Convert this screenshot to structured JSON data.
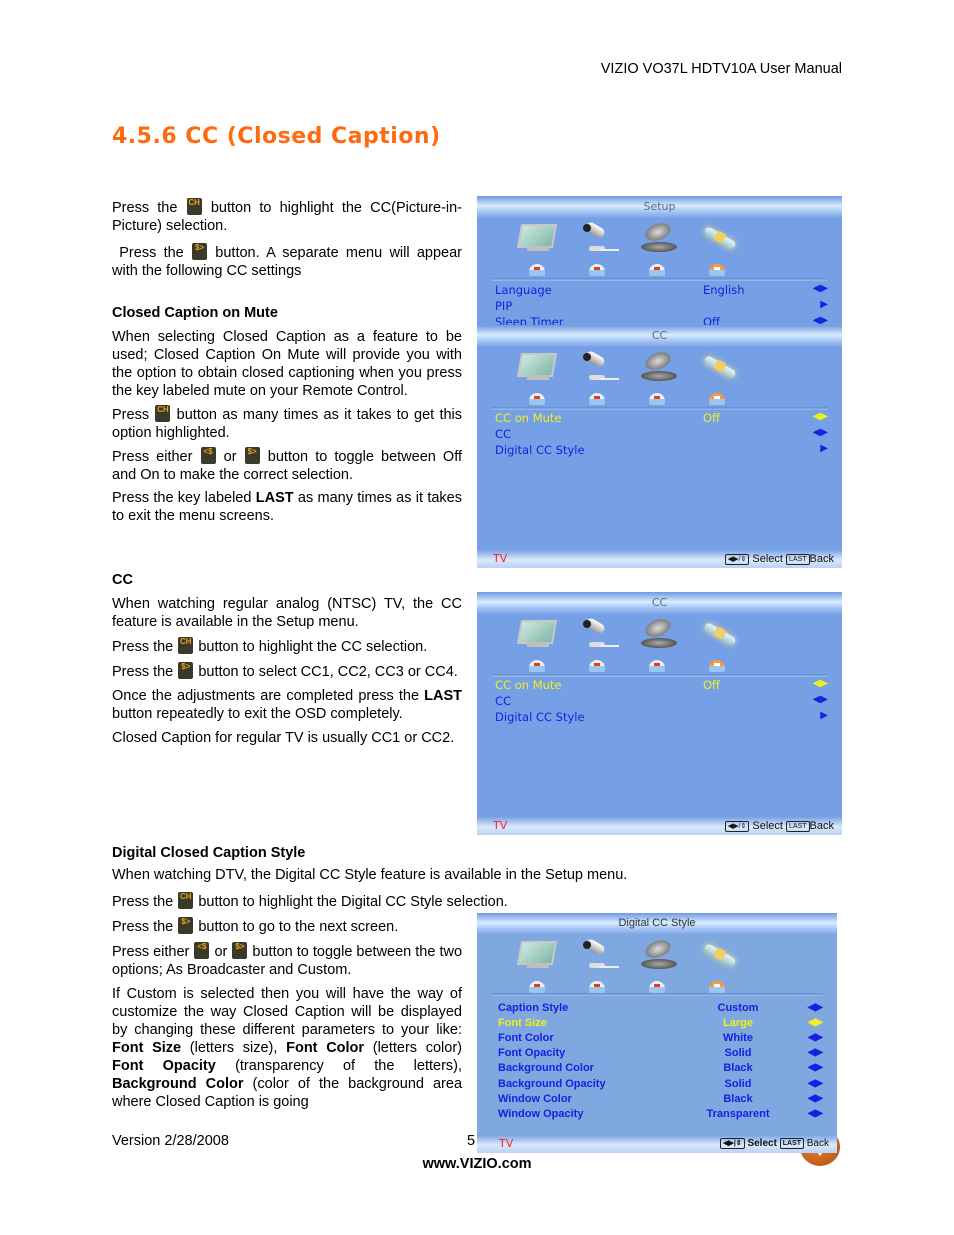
{
  "header": {
    "doc_title": "VIZIO VO37L HDTV10A User Manual"
  },
  "section_title": "4.5.6 CC (Closed Caption)",
  "intro": {
    "p1_a": "Press the",
    "p1_b": "button to highlight the CC(Picture-in-Picture) selection.",
    "p2_a": "Press the",
    "p2_b": "button. A separate menu will appear with the following CC settings"
  },
  "cc_on_mute": {
    "heading": "Closed Caption on Mute",
    "p1": "When selecting Closed Caption as a feature to be used; Closed Caption On Mute will provide you with the option to obtain closed captioning when you press the key labeled mute on your Remote Control.",
    "p2_a": "Press",
    "p2_b": "button as many times as it takes to get this option highlighted.",
    "p3_a": "Press either",
    "p3_or": "or",
    "p3_b": "button to toggle between Off and On to make the correct selection.",
    "p4_a": "Press the key labeled",
    "p4_bold": "LAST",
    "p4_b": "as many times as it takes to exit the menu screens."
  },
  "cc": {
    "heading": "CC",
    "p1": "When watching regular analog (NTSC) TV, the CC feature is available in the Setup menu.",
    "p2_a": "Press the",
    "p2_b": "button to highlight the CC selection.",
    "p3_a": "Press the",
    "p3_b": "button to select CC1, CC2, CC3 or CC4.",
    "p4_a": "Once the adjustments are completed press the",
    "p4_bold": "LAST",
    "p4_b": "button repeatedly to exit the OSD completely.",
    "p5": "Closed Caption for regular TV is usually CC1 or CC2."
  },
  "digital": {
    "heading": "Digital Closed Caption Style",
    "p1": "When watching DTV, the Digital CC Style feature is available in the Setup menu.",
    "p2_a": "Press the",
    "p2_b": "button to highlight the Digital CC Style selection.",
    "p3_a": "Press the",
    "p3_b": "button to go to the next screen.",
    "p4_a": "Press either",
    "p4_or": "or",
    "p4_b": "button to toggle between the two options; As Broadcaster and Custom.",
    "p5_a": "If Custom is selected then you will have the way of customize the way Closed Caption will be displayed by changing these different parameters to your like:",
    "p5_fs": "Font Size",
    "p5_fs_d": "(letters size),",
    "p5_fc": "Font Color",
    "p5_fc_d": "(letters color)",
    "p5_fo": "Font Opacity",
    "p5_fo_d": "(transparency of the letters),",
    "p5_bc": "Background Color",
    "p5_bc_d": "(color of the background area where Closed Caption is going"
  },
  "remote_buttons": {
    "ch_down": "CH",
    "vol_right": "$>",
    "vol_left": "<$"
  },
  "osd_setup": {
    "title": "Setup",
    "rows": [
      {
        "label": "Language",
        "value": "English",
        "arrow": "◀▶"
      },
      {
        "label": "PIP",
        "value": "",
        "arrow": "▶"
      },
      {
        "label": "Sleep Timer",
        "value": "Off",
        "arrow": "◀▶"
      }
    ]
  },
  "osd_cc1": {
    "title": "CC",
    "rows": [
      {
        "label": "CC on Mute",
        "value": "Off",
        "arrow": "◀▶",
        "highlighted": true
      },
      {
        "label": "CC",
        "value": "",
        "arrow": "◀▶"
      },
      {
        "label": "Digital CC Style",
        "value": "",
        "arrow": "▶"
      }
    ],
    "footer": {
      "source": "TV",
      "select": "Select",
      "last_key": "LAST",
      "back": "Back"
    }
  },
  "osd_cc2": {
    "title": "CC",
    "rows": [
      {
        "label": "CC on Mute",
        "value": "Off",
        "arrow": "◀▶",
        "highlighted": true
      },
      {
        "label": "CC",
        "value": "",
        "arrow": "◀▶"
      },
      {
        "label": "Digital CC Style",
        "value": "",
        "arrow": "▶"
      }
    ],
    "footer": {
      "source": "TV",
      "select": "Select",
      "last_key": "LAST",
      "back": "Back"
    }
  },
  "osd_dcc": {
    "title": "Digital CC Style",
    "rows": [
      {
        "label": "Caption Style",
        "value": "Custom",
        "arrow": "◀▶"
      },
      {
        "label": "Font Size",
        "value": "Large",
        "arrow": "◀▶",
        "highlighted": true
      },
      {
        "label": "Font Color",
        "value": "White",
        "arrow": "◀▶"
      },
      {
        "label": "Font Opacity",
        "value": "Solid",
        "arrow": "◀▶"
      },
      {
        "label": "Background Color",
        "value": "Black",
        "arrow": "◀▶"
      },
      {
        "label": "Background Opacity",
        "value": "Solid",
        "arrow": "◀▶"
      },
      {
        "label": "Window Color",
        "value": "Black",
        "arrow": "◀▶"
      },
      {
        "label": "Window Opacity",
        "value": "Transparent",
        "arrow": "◀▶"
      }
    ],
    "footer": {
      "source": "TV",
      "select": "Select",
      "last_key": "LAST",
      "back": "Back"
    }
  },
  "osd_colors": {
    "panel": "#76a0e6",
    "item_text": "#1520e0",
    "highlight_text": "#f0f020",
    "source_text": "#ff2020"
  },
  "footer": {
    "version": "Version 2/28/2008",
    "page": "5",
    "url": "www.VIZIO.com"
  },
  "accent_color": "#ff6a10"
}
